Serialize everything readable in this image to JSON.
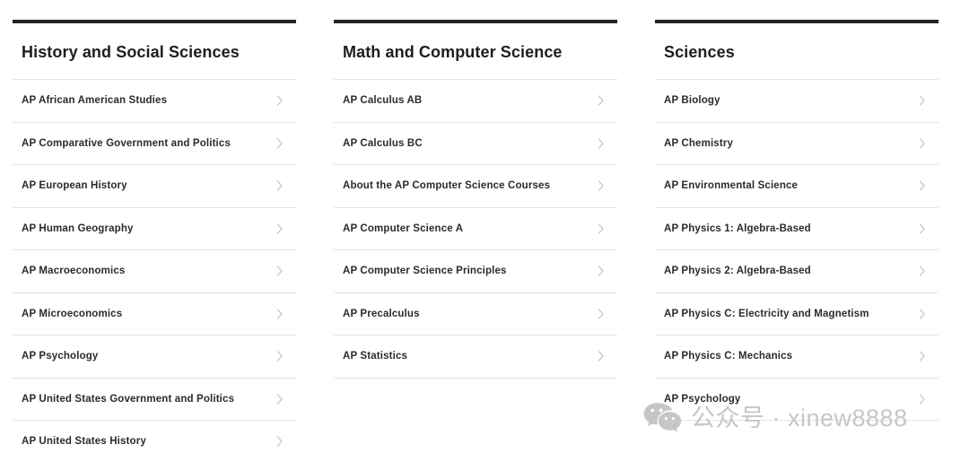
{
  "columns": [
    {
      "title": "History and Social Sciences",
      "courses": [
        "AP African American Studies",
        "AP Comparative Government and Politics",
        "AP European History",
        "AP Human Geography",
        "AP Macroeconomics",
        "AP Microeconomics",
        "AP Psychology",
        "AP United States Government and Politics",
        "AP United States History"
      ]
    },
    {
      "title": "Math and Computer Science",
      "courses": [
        "AP Calculus AB",
        "AP Calculus BC",
        "About the AP Computer Science Courses",
        "AP Computer Science A",
        "AP Computer Science Principles",
        "AP Precalculus",
        "AP Statistics"
      ]
    },
    {
      "title": "Sciences",
      "courses": [
        "AP Biology",
        "AP Chemistry",
        "AP Environmental Science",
        "AP Physics 1: Algebra-Based",
        "AP Physics 2: Algebra-Based",
        "AP Physics C: Electricity and Magnetism",
        "AP Physics C: Mechanics",
        "AP Psychology"
      ]
    }
  ],
  "watermark": {
    "text": "公众号 · xinew8888",
    "icon": "wechat-icon",
    "color": "#c6c6c6"
  },
  "theme": {
    "rule_color": "#232323",
    "divider_color": "#e4e4e4",
    "title_color": "#1e1e1e",
    "label_color": "#2b2b2b",
    "chevron_color": "#c9cdd3",
    "background": "#ffffff"
  }
}
